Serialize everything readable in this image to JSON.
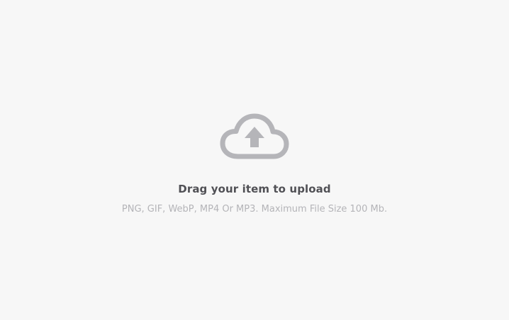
{
  "upload": {
    "title": "Drag your item to upload",
    "subtitle": "PNG, GIF, WebP, MP4 Or MP3. Maximum File Size 100 Mb.",
    "icon": "cloud-upload-icon"
  },
  "colors": {
    "background": "#f7f7f7",
    "icon": "#b5b5b9",
    "title": "#505055",
    "subtitle": "#b4b4b8"
  }
}
